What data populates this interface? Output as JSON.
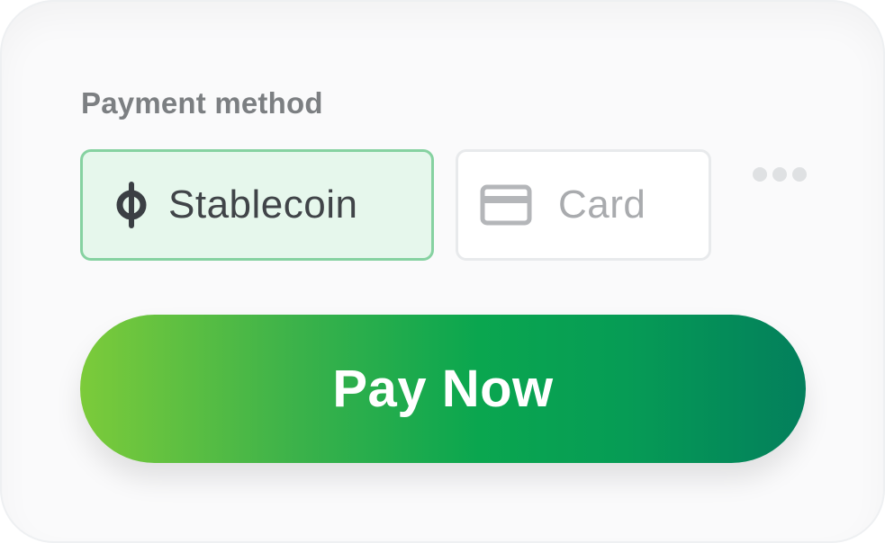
{
  "payment": {
    "label": "Payment method",
    "options": [
      {
        "label": "Stablecoin",
        "icon": "stablecoin-icon",
        "selected": true
      },
      {
        "label": "Card",
        "icon": "credit-card-icon",
        "selected": false
      }
    ],
    "more_icon": "more-dots-icon"
  },
  "actions": {
    "pay_label": "Pay Now"
  },
  "colors": {
    "accent_start": "#7ccb3a",
    "accent_end": "#037f5c",
    "selected_bg": "#e6f7ec",
    "selected_border": "#86d2a1"
  }
}
